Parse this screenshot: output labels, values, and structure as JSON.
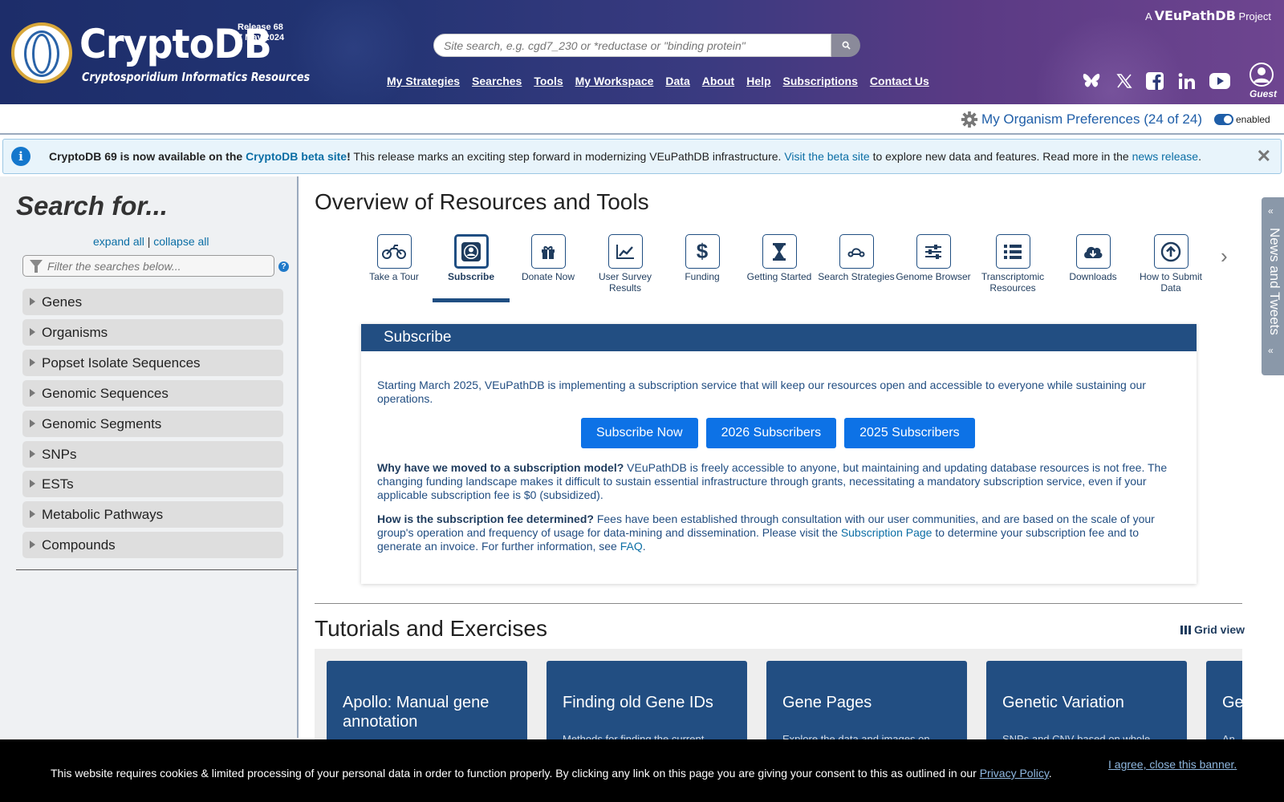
{
  "header": {
    "brand": "CryptoDB",
    "subtitle": "Cryptosporidium Informatics Resources",
    "release": "Release 68",
    "release_date": "7 May 2024",
    "project_prefix": "A",
    "project_name": "VEuPathDB",
    "project_suffix": "Project",
    "search_placeholder": "Site search, e.g. cgd7_230 or *reductase or \"binding protein\"",
    "nav": [
      "My Strategies",
      "Searches",
      "Tools",
      "My Workspace",
      "Data",
      "About",
      "Help",
      "Subscriptions",
      "Contact Us"
    ],
    "social_icons": [
      "bluesky-icon",
      "x-twitter-icon",
      "facebook-icon",
      "linkedin-icon",
      "youtube-icon"
    ],
    "guest_label": "Guest"
  },
  "prefs": {
    "label": "My Organism Preferences (24 of 24)",
    "toggle_label": "enabled"
  },
  "announcement": {
    "bold": "CryptoDB 69 is now available on the",
    "link1": "CryptoDB beta site",
    "bang": "!",
    "text1": " This release marks an exciting step forward in modernizing VEuPathDB infrastructure. ",
    "link2": "Visit the beta site",
    "text2": " to explore new data and features. Read more in the ",
    "link3": "news release",
    "text3": "."
  },
  "sidebar": {
    "title": "Search for...",
    "expand_all": "expand all",
    "separator": "|",
    "collapse_all": "collapse all",
    "filter_placeholder": "Filter the searches below...",
    "help": "?",
    "categories": [
      "Genes",
      "Organisms",
      "Popset Isolate Sequences",
      "Genomic Sequences",
      "Genomic Segments",
      "SNPs",
      "ESTs",
      "Metabolic Pathways",
      "Compounds"
    ]
  },
  "overview": {
    "title": "Overview of Resources and Tools",
    "tools": [
      {
        "label": "Take a Tour",
        "icon": "motorcycle-icon"
      },
      {
        "label": "Subscribe",
        "icon": "user-circle-icon",
        "active": true
      },
      {
        "label": "Donate Now",
        "icon": "gift-icon"
      },
      {
        "label": "User Survey Results",
        "icon": "chart-line-icon"
      },
      {
        "label": "Funding",
        "icon": "dollar-icon"
      },
      {
        "label": "Getting Started",
        "icon": "hourglass-icon"
      },
      {
        "label": "Search Strategies",
        "icon": "strategy-icon"
      },
      {
        "label": "Genome Browser",
        "icon": "sliders-icon"
      },
      {
        "label": "Transcriptomic Resources",
        "icon": "list-icon"
      },
      {
        "label": "Downloads",
        "icon": "cloud-download-icon"
      },
      {
        "label": "How to Submit Data",
        "icon": "upload-circle-icon"
      }
    ]
  },
  "subscribe_panel": {
    "title": "Subscribe",
    "intro": "Starting March 2025, VEuPathDB is implementing a subscription service that will keep our resources open and accessible to everyone while sustaining our operations.",
    "buttons": [
      "Subscribe Now",
      "2026 Subscribers",
      "2025 Subscribers"
    ],
    "q1_bold": "Why have we moved to a subscription model?",
    "q1_text": " VEuPathDB is freely accessible to anyone, but maintaining and updating database resources is not free. The changing funding landscape makes it difficult to sustain essential infrastructure through grants, necessitating a mandatory subscription service, even if your applicable subscription fee is $0 (subsidized).",
    "q2_bold": "How is the subscription fee determined?",
    "q2_text1": " Fees have been established through consultation with our user communities, and are based on the scale of your group's operation and frequency of usage for data-mining and dissemination. Please visit the ",
    "q2_link1": "Subscription Page",
    "q2_text2": " to determine your subscription fee and to generate an invoice. For further information, see ",
    "q2_link2": "FAQ",
    "q2_text3": "."
  },
  "tutorials": {
    "title": "Tutorials and Exercises",
    "grid_view": "Grid view",
    "cards": [
      {
        "title": "Apollo: Manual gene annotation",
        "desc": ""
      },
      {
        "title": "Finding old Gene IDs",
        "desc": "Methods for finding the current"
      },
      {
        "title": "Gene Pages",
        "desc": "Explore the data and images on"
      },
      {
        "title": "Genetic Variation",
        "desc": "SNPs and CNV based on whole"
      },
      {
        "title": "Ge",
        "desc": "An"
      }
    ]
  },
  "news_tab": {
    "label": "News and Tweets"
  },
  "cookie": {
    "text": "This website requires cookies & limited processing of your personal data in order to function properly. By clicking any link on this page you are giving your consent to this as outlined in our ",
    "link": "Privacy Policy",
    "end": ".",
    "close": "I agree, close this banner."
  },
  "colors": {
    "header_dark": "#1d2d6a",
    "header_purple": "#6e4590",
    "panel_blue": "#224e82",
    "button_blue": "#0d72e6",
    "link_blue": "#0b6ea5"
  }
}
